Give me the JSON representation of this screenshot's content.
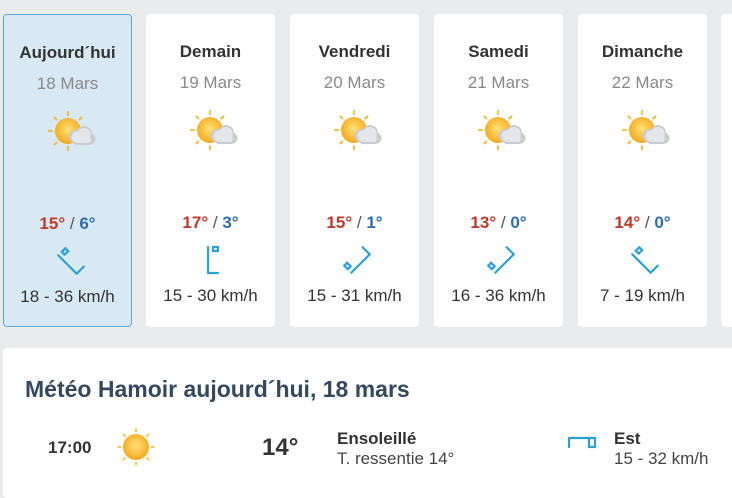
{
  "forecast": [
    {
      "day": "Aujourd´hui",
      "date": "18 Mars",
      "tmax": "15°",
      "tmin": "6°",
      "wind": "18 - 36 km/h",
      "icon": "partly-cloudy-icon",
      "wind_dir_icon": "wind-arrow-icon"
    },
    {
      "day": "Demain",
      "date": "19 Mars",
      "tmax": "17°",
      "tmin": "3°",
      "wind": "15 - 30 km/h",
      "icon": "partly-cloudy-icon",
      "wind_dir_icon": "wind-arrow-icon"
    },
    {
      "day": "Vendredi",
      "date": "20 Mars",
      "tmax": "15°",
      "tmin": "1°",
      "wind": "15 - 31 km/h",
      "icon": "partly-cloudy-icon",
      "wind_dir_icon": "wind-arrow-icon"
    },
    {
      "day": "Samedi",
      "date": "21 Mars",
      "tmax": "13°",
      "tmin": "0°",
      "wind": "16 - 36 km/h",
      "icon": "partly-cloudy-icon",
      "wind_dir_icon": "wind-arrow-icon"
    },
    {
      "day": "Dimanche",
      "date": "22 Mars",
      "tmax": "14°",
      "tmin": "0°",
      "wind": "7 - 19 km/h",
      "icon": "partly-cloudy-icon",
      "wind_dir_icon": "wind-arrow-icon"
    }
  ],
  "separator": "/",
  "detail": {
    "title": "Météo Hamoir aujourd´hui, 18 mars",
    "time": "17:00",
    "icon": "sun-icon",
    "temp": "14°",
    "condition": "Ensoleillé",
    "feels_like": "T. ressentie 14°",
    "wind_dir": "Est",
    "wind_speed": "15 - 32 km/h"
  },
  "colors": {
    "tmax": "#c0392b",
    "tmin": "#2e6db4",
    "accent": "#2a9fd8",
    "active_bg": "#d8e9f4",
    "active_border": "#5ba7d6"
  }
}
